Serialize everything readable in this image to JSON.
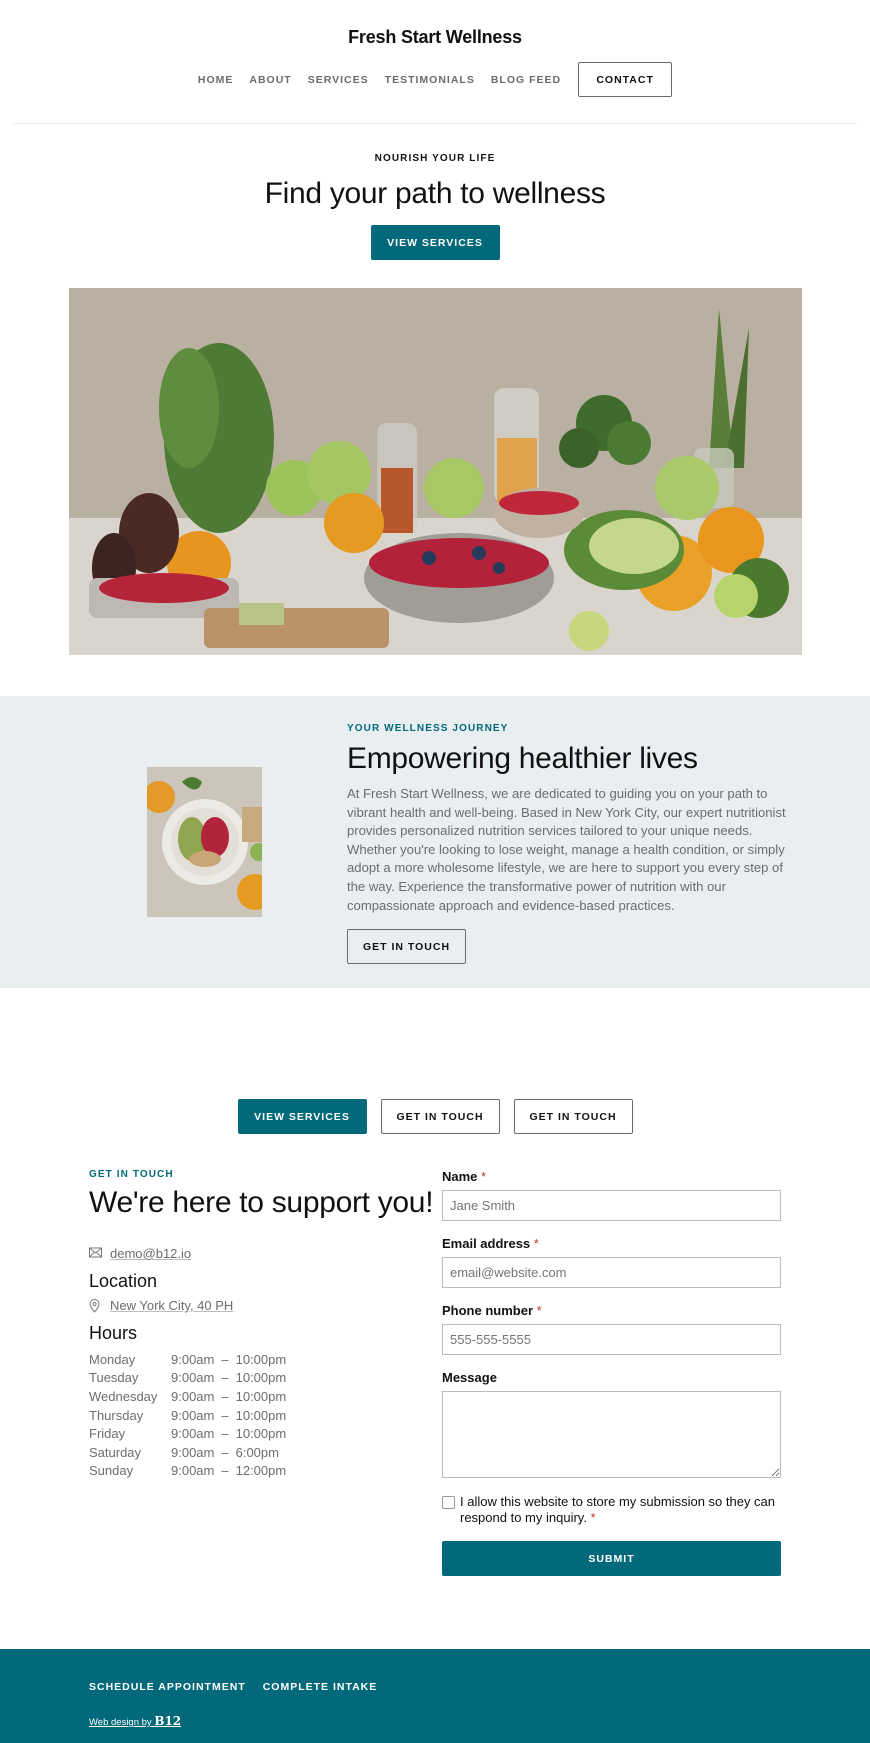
{
  "header": {
    "site_title": "Fresh Start Wellness",
    "nav": [
      {
        "label": "HOME"
      },
      {
        "label": "ABOUT"
      },
      {
        "label": "SERVICES"
      },
      {
        "label": "TESTIMONIALS"
      },
      {
        "label": "BLOG FEED"
      }
    ],
    "contact_label": "CONTACT"
  },
  "hero": {
    "eyebrow": "NOURISH YOUR LIFE",
    "title": "Find your path to wellness",
    "cta_label": "VIEW SERVICES",
    "image_alt": "Table spread of fresh fruits, vegetables, berries, juices and grains"
  },
  "journey": {
    "eyebrow": "YOUR WELLNESS JOURNEY",
    "title": "Empowering healthier lives",
    "body": "At Fresh Start Wellness, we are dedicated to guiding you on your path to vibrant health and well-being. Based in New York City, our expert nutritionist provides personalized nutrition services tailored to your unique needs. Whether you're looking to lose weight, manage a health condition, or simply adopt a more wholesome lifestyle, we are here to support you every step of the way. Experience the transformative power of nutrition with our compassionate approach and evidence-based practices.",
    "cta_label": "GET IN TOUCH",
    "image_alt": "Plate of salad with berries, grains and vegetables"
  },
  "cta_row": {
    "primary_label": "VIEW SERVICES",
    "secondary_label_1": "GET IN TOUCH",
    "secondary_label_2": "GET IN TOUCH"
  },
  "contact": {
    "eyebrow": "GET IN TOUCH",
    "title": "We're here to support you!",
    "email": "demo@b12.io",
    "location_heading": "Location",
    "location": "New York City, 40 PH",
    "hours_heading": "Hours",
    "hours": [
      {
        "day": "Monday",
        "open": "9:00am",
        "close": "10:00pm"
      },
      {
        "day": "Tuesday",
        "open": "9:00am",
        "close": "10:00pm"
      },
      {
        "day": "Wednesday",
        "open": "9:00am",
        "close": "10:00pm"
      },
      {
        "day": "Thursday",
        "open": "9:00am",
        "close": "10:00pm"
      },
      {
        "day": "Friday",
        "open": "9:00am",
        "close": "10:00pm"
      },
      {
        "day": "Saturday",
        "open": "9:00am",
        "close": "6:00pm"
      },
      {
        "day": "Sunday",
        "open": "9:00am",
        "close": "12:00pm"
      }
    ],
    "dash": "–"
  },
  "form": {
    "name_label": "Name",
    "name_placeholder": "Jane Smith",
    "email_label": "Email address",
    "email_placeholder": "email@website.com",
    "phone_label": "Phone number",
    "phone_placeholder": "555-555-5555",
    "message_label": "Message",
    "message_value": "",
    "required_mark": "*",
    "consent_text": "I allow this website to store my submission so they can respond to my inquiry.",
    "consent_checked": false,
    "submit_label": "SUBMIT"
  },
  "footer": {
    "links": [
      {
        "label": "SCHEDULE APPOINTMENT"
      },
      {
        "label": "COMPLETE INTAKE"
      }
    ],
    "credit_prefix": "Web design by ",
    "credit_brand": "B12"
  },
  "colors": {
    "brand": "#02697a",
    "section_bg": "#e9eef0",
    "required": "#c0392b"
  }
}
